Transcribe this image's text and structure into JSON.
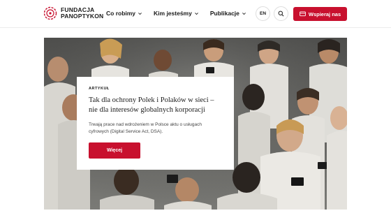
{
  "brand": {
    "line1": "FUNDACJA",
    "line2": "PANOPTYKON",
    "accent": "#c8102e"
  },
  "nav": {
    "items": [
      {
        "label": "Co robimy",
        "icon": "chevron-down-icon"
      },
      {
        "label": "Kim jesteśmy",
        "icon": "chevron-down-icon"
      },
      {
        "label": "Publikacje",
        "icon": "chevron-down-icon"
      }
    ]
  },
  "header": {
    "lang_label": "EN",
    "search_icon": "search-icon",
    "support_label": "Wspieraj nas",
    "support_icon": "donate-card-icon"
  },
  "hero": {
    "image": "crowd-of-people-looking-at-phones",
    "card": {
      "tag": "ARTYKUŁ",
      "headline": "Tak dla ochrony Polek i Polaków w sieci – nie dla interesów globalnych korporacji",
      "summary": "Trwają prace nad wdrożeniem w Polsce aktu o usługach cyfrowych (Digital Service Act, DSA).",
      "button_label": "Więcej"
    }
  }
}
